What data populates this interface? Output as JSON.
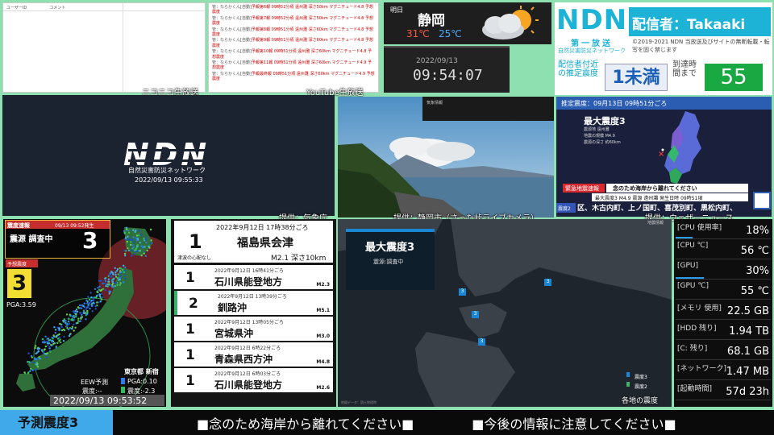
{
  "chat": {
    "col_user": "ユーザーID",
    "col_comment": "コメント",
    "label": "ニコニコ生放送"
  },
  "yt": {
    "label": "YouTube生放送",
    "messages": [
      {
        "user": "管：ならかくん[自動]",
        "text": "予報第6報 09時52分頃 遠州灘 深さ50km マグニチュード4.8 予想震度"
      },
      {
        "user": "管：ならかくん[自動]",
        "text": "予報第7報 09時52分頃 遠州灘 深さ50km マグニチュード4.8 予想震度"
      },
      {
        "user": "管：ならかくん[自動]",
        "text": "予報第8報 09時51分頃 遠州灘 深さ60km マグニチュード4.8 予想震度"
      },
      {
        "user": "管：ならかくん[自動]",
        "text": "予報第9報 09時51分頃 遠州灘 深さ60km マグニチュード4.8 予想震度"
      },
      {
        "user": "管：ならかくん[自動]",
        "text": "予報第10報 09時51分頃 遠州灘 深さ60km マグニチュード4.8 予想震度"
      },
      {
        "user": "管：ならかくん[自動]",
        "text": "予報第11報 09時51分頃 遠州灘 深さ60km マグニチュード4.9 予想震度"
      },
      {
        "user": "管：ならかくん[自動]",
        "text": "予報最終報 09時51分頃 遠州灘 深さ60km マグニチュード4.9 予想震度"
      }
    ]
  },
  "weather": {
    "day": "明日",
    "city": "静岡",
    "high": "31℃",
    "low": "25℃",
    "icon": "partly-cloudy-icon"
  },
  "clock": {
    "date": "2022/09/13",
    "time": "09:54:07"
  },
  "ndn": {
    "logo": "NDN",
    "channel": "第一放送",
    "sub": "自然災害防災ネットワーク",
    "caster": "配信者：Takaaki",
    "copyright": "©2019-2021 NDN 当放送及びサイトの無断転載・転写を固く禁じます",
    "est_label": "配信者付近の推定震度",
    "est_value": "1未満",
    "arrival_label": "到達時間まで",
    "arrival_value": "55"
  },
  "ndnwindow": {
    "logo": "NDN",
    "sub": "自然災害防災ネットワーク",
    "time": "2022/09/13 09:55:33"
  },
  "camera": {
    "credit": "提供：静岡市（さった峠ライブカメラ）",
    "source_credit": "提供：気象庁"
  },
  "eqmap": {
    "header": "推定震度：09月13日 09時51分ごろ",
    "max": "最大震度3",
    "details": [
      "震源地 遠州灘",
      "地震の規模 M4.9",
      "震源の深さ 約60km"
    ],
    "alert_label": "緊急地震速報",
    "alert_text": "念のため海岸から離れてください",
    "alert_row": "最大震度3 M4.9 震源 遠州灘 発生日時 09時51頃",
    "scroll": "区、木古内町、上ノ国町、喜茂別町、黒松内町、",
    "shindo_tag": "震度2",
    "credit": "提供：ウェザーニュース"
  },
  "kmoni": {
    "header": "震度速報",
    "header_time": "09/13 09:52発生",
    "origin": "震源 調査中",
    "origin_int": "3",
    "pred_label": "予想震度",
    "pred_int": "3",
    "pga": "PGA:3.59",
    "city": "東京都 新宿",
    "eew": "EEW予測",
    "eew_int": "震度:--",
    "pga2": "PGA:0.10",
    "int2": "震度:-2.3",
    "time": "2022/09/13 09:53:52"
  },
  "eqlist": {
    "top": {
      "dt": "2022年9月12日 17時38分ごろ",
      "int": "1",
      "place": "福島県会津",
      "note": "津波の心配なし",
      "mag": "M2.1 深さ10km"
    },
    "rows": [
      {
        "dt": "2022年9月12日 16時41分ごろ",
        "int": "1",
        "place": "石川県能登地方",
        "mag": "M2.3"
      },
      {
        "dt": "2022年9月12日 13時39分ごろ",
        "int": "2",
        "place": "釧路沖",
        "mag": "M5.1"
      },
      {
        "dt": "2022年9月12日 13時05分ごろ",
        "int": "1",
        "place": "宮城県沖",
        "mag": "M3.0"
      },
      {
        "dt": "2022年9月12日 6時22分ごろ",
        "int": "1",
        "place": "青森県西方沖",
        "mag": "M4.8"
      },
      {
        "dt": "2022年9月12日 6時03分ごろ",
        "int": "1",
        "place": "石川県能登地方",
        "mag": "M2.6"
      }
    ]
  },
  "detailmap": {
    "max": "最大震度3",
    "sub": "震源:調査中",
    "top_right": "地震情報",
    "legend": [
      "震度3",
      "震度2"
    ],
    "caption": "各地の震度",
    "credit": "地図データ：国土地理院"
  },
  "sysmon": [
    {
      "k": "[CPU 使用率]",
      "v": "18%",
      "pct": 18
    },
    {
      "k": "[CPU ℃]",
      "v": "56 ℃",
      "pct": 0
    },
    {
      "k": "[GPU]",
      "v": "30%",
      "pct": 30
    },
    {
      "k": "[GPU ℃]",
      "v": "55 ℃",
      "pct": 0
    },
    {
      "k": "[メモリ 使用]",
      "v": "22.5 GB",
      "pct": 0
    },
    {
      "k": "[HDD 残り]",
      "v": "1.94 TB",
      "pct": 0
    },
    {
      "k": "[C: 残り]",
      "v": "68.1 GB",
      "pct": 0
    },
    {
      "k": "[ネットワーク]",
      "v": "1.47 MB",
      "pct": 0
    },
    {
      "k": "[起動時間]",
      "v": "57d 23h",
      "pct": 0
    }
  ],
  "ticker": {
    "label": "予測震度3",
    "msg1": "■念のため海岸から離れてください■",
    "msg2": "■今後の情報に注意してください■"
  }
}
